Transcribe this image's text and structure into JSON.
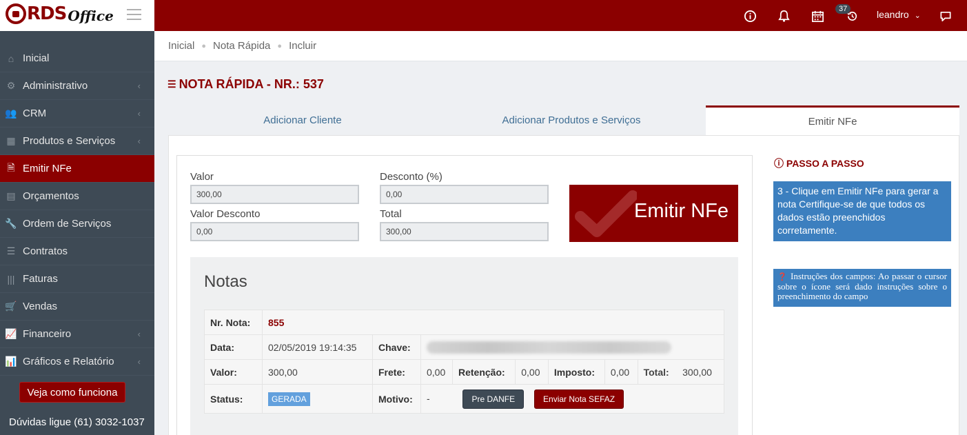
{
  "app": {
    "logo_text": "RDS",
    "logo_text2": "Office"
  },
  "sidebar": {
    "items": [
      {
        "label": "Inicial",
        "icon": "home-icon",
        "has_submenu": false
      },
      {
        "label": "Administrativo",
        "icon": "gear-icon",
        "has_submenu": true
      },
      {
        "label": "CRM",
        "icon": "users-icon",
        "has_submenu": true
      },
      {
        "label": "Produtos e Serviços",
        "icon": "cubes-icon",
        "has_submenu": true
      },
      {
        "label": "Emitir NFe",
        "icon": "file-code-icon",
        "has_submenu": false,
        "active": true
      },
      {
        "label": "Orçamentos",
        "icon": "document-icon",
        "has_submenu": false
      },
      {
        "label": "Ordem de Serviços",
        "icon": "wrench-icon",
        "has_submenu": false
      },
      {
        "label": "Contratos",
        "icon": "list-icon",
        "has_submenu": false
      },
      {
        "label": "Faturas",
        "icon": "barcode-icon",
        "has_submenu": false
      },
      {
        "label": "Vendas",
        "icon": "cart-icon",
        "has_submenu": false
      },
      {
        "label": "Financeiro",
        "icon": "line-chart-icon",
        "has_submenu": true
      },
      {
        "label": "Gráficos e Relatório",
        "icon": "bar-chart-icon",
        "has_submenu": true
      }
    ],
    "how_button": "Veja como funciona",
    "phone": "Dúvidas ligue (61) 3032-1037"
  },
  "topbar": {
    "badge_count": "37",
    "user": "leandro"
  },
  "breadcrumb": {
    "items": [
      "Inicial",
      "Nota Rápida",
      "Incluir"
    ]
  },
  "page": {
    "title": "NOTA RÁPIDA - NR.: 537"
  },
  "tabs": [
    "Adicionar Cliente",
    "Adicionar Produtos e Serviços",
    "Emitir NFe"
  ],
  "form": {
    "valor_label": "Valor",
    "valor": "300,00",
    "desconto_label": "Desconto (%)",
    "desconto": "0,00",
    "valor_desconto_label": "Valor Desconto",
    "valor_desconto": "0,00",
    "total_label": "Total",
    "total": "300,00"
  },
  "emit_button": "Emitir NFe",
  "notas": {
    "title": "Notas",
    "nr_label": "Nr. Nota:",
    "nr": "855",
    "data_label": "Data:",
    "data": "02/05/2019 19:14:35",
    "chave_label": "Chave:",
    "valor_label": "Valor:",
    "valor": "300,00",
    "frete_label": "Frete:",
    "frete": "0,00",
    "retencao_label": "Retenção:",
    "retencao": "0,00",
    "imposto_label": "Imposto:",
    "imposto": "0,00",
    "total_label": "Total:",
    "total": "300,00",
    "status_label": "Status:",
    "status": "GERADA",
    "motivo_label": "Motivo:",
    "motivo": "-",
    "pre_danfe": "Pre DANFE",
    "enviar": "Enviar Nota SEFAZ"
  },
  "help": {
    "title": "PASSO A PASSO",
    "step": "3 - Clique em Emitir NFe para gerar a nota Certifique-se de que todos os dados estão preenchidos corretamente.",
    "instructions": "Instruções dos campos: Ao passar o cursor sobre o ícone será dado instruções sobre o preenchimento do campo"
  },
  "colors": {
    "brand": "#8b0000",
    "sidebar": "#3e4a55",
    "info": "#3c7fbf",
    "status": "#62a0dd"
  }
}
